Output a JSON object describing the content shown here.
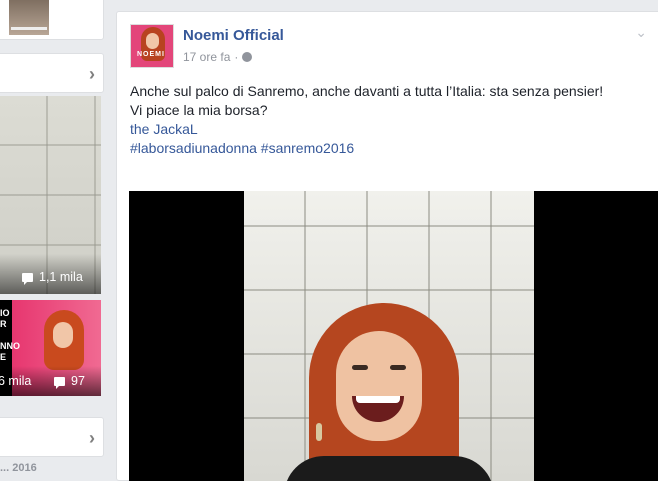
{
  "sidebar": {
    "video1_comments": "1,1 mila",
    "video2_views_fragment": "6 mila",
    "video2_comments": "97",
    "video2_text_fragment": [
      "IO",
      "R",
      "NNO",
      "E"
    ],
    "date_fragment": "... 2016"
  },
  "post": {
    "page_name": "Noemi Official",
    "avatar_label": "NOEMI",
    "time": "17 ore fa",
    "separator": "·",
    "text_line1": "Anche sul palco di Sanremo, anche davanti a tutta l’Italia: sta senza pensier!",
    "text_line2": "Vi piace la mia borsa?",
    "mention": "the JackaL",
    "hashtags": "#laborsadiunadonna #sanremo2016"
  },
  "icons": {
    "comment": "comment-icon",
    "globe": "globe-icon",
    "chevron": "chevron-right-icon",
    "post_menu": "chevron-down-icon"
  }
}
